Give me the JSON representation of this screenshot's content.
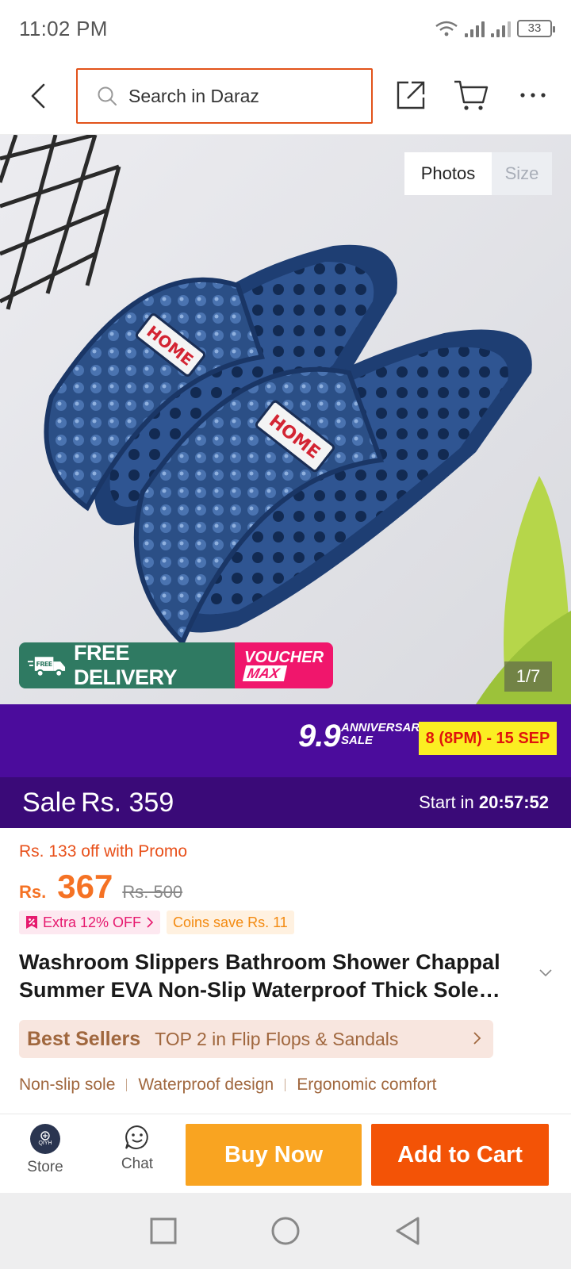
{
  "status_bar": {
    "time": "11:02 PM",
    "battery": "33"
  },
  "search": {
    "placeholder": "Search in Daraz"
  },
  "media": {
    "tabs": [
      "Photos",
      "Size"
    ],
    "counter": "1/7",
    "badges": {
      "free_word": "FREE",
      "free_delivery": "FREE DELIVERY",
      "voucher": "VOUCHER",
      "max": "MAX"
    },
    "product_print": "HOME"
  },
  "campaign": {
    "event_number": "9.9",
    "event_line1": "ANNIVERSARY",
    "event_line2": "SALE",
    "dates": "8 (8PM) - 15 SEP",
    "sale_label": "Sale",
    "sale_price": "Rs. 359",
    "start_label": "Start in",
    "countdown": "20:57:52"
  },
  "pricing": {
    "promo_off": "Rs. 133 off with Promo",
    "currency": "Rs.",
    "price": "367",
    "original_price": "Rs. 500",
    "extra_off": "Extra 12% OFF",
    "coins": "Coins save Rs. 11"
  },
  "product": {
    "title_line1": "Washroom Slippers Bathroom Shower Chappal",
    "title_line2": "Summer EVA Non-Slip Waterproof Thick Sole…"
  },
  "best_sellers": {
    "label": "Best Sellers",
    "rank_text": "TOP 2 in Flip Flops & Sandals"
  },
  "features": [
    "Non-slip sole",
    "Waterproof design",
    "Ergonomic comfort"
  ],
  "actions": {
    "store": "Store",
    "store_logo": "QIYH",
    "chat": "Chat",
    "buy_now": "Buy Now",
    "add_to_cart": "Add to Cart"
  },
  "colors": {
    "accent_orange": "#f57224",
    "search_border": "#e2531b",
    "campaign_purple": "#4b0c9c",
    "buy_now": "#f9a421",
    "add_to_cart": "#f35306"
  }
}
